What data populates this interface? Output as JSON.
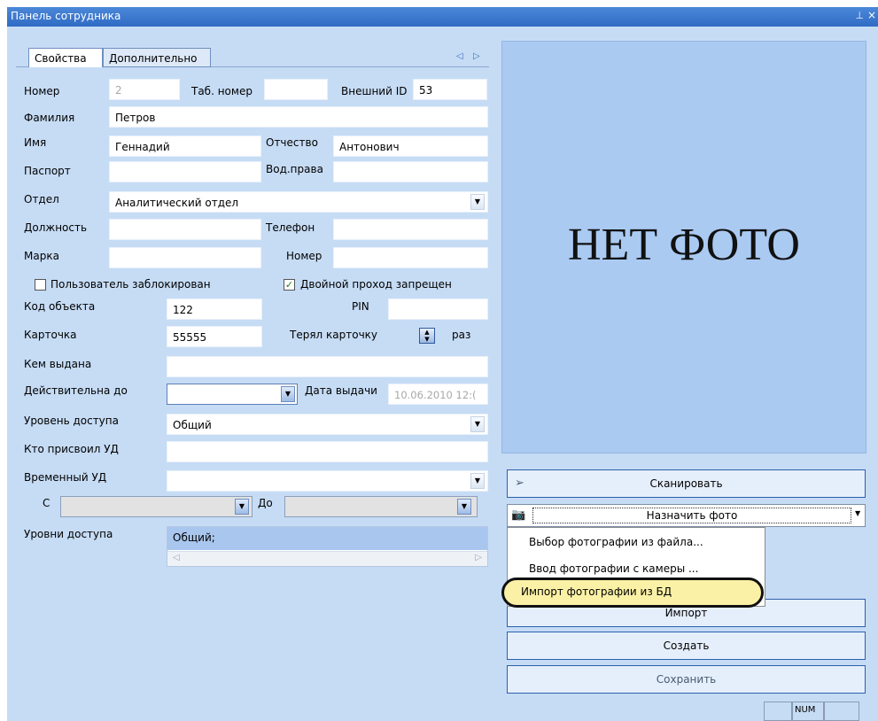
{
  "window": {
    "title": "Панель сотрудника",
    "pin_glyph": "⊥",
    "close_glyph": "×"
  },
  "tabs": [
    {
      "label": "Свойства",
      "active": true
    },
    {
      "label": "Дополнительно",
      "active": false
    }
  ],
  "tab_nav": {
    "prev": "◁",
    "next": "▷"
  },
  "fields": {
    "number": {
      "label": "Номер",
      "value": "2"
    },
    "tab_number": {
      "label": "Таб. номер",
      "value": ""
    },
    "external_id": {
      "label": "Внешний ID",
      "value": "53"
    },
    "surname": {
      "label": "Фамилия",
      "value": "Петров"
    },
    "name": {
      "label": "Имя",
      "value": "Геннадий"
    },
    "patronymic": {
      "label": "Отчество",
      "value": "Антонович"
    },
    "passport": {
      "label": "Паспорт",
      "value": ""
    },
    "license": {
      "label": "Вод.права",
      "value": ""
    },
    "department": {
      "label": "Отдел",
      "value": "Аналитический отдел"
    },
    "position": {
      "label": "Должность",
      "value": ""
    },
    "phone": {
      "label": "Телефон",
      "value": ""
    },
    "brand": {
      "label": "Марка",
      "value": ""
    },
    "plate": {
      "label": "Номер",
      "value": ""
    },
    "object_code": {
      "label": "Код объекта",
      "value": "122"
    },
    "pin": {
      "label": "PIN",
      "value": ""
    },
    "card": {
      "label": "Карточка",
      "value": "55555"
    },
    "lost_card": {
      "label": "Терял карточку",
      "suffix": "раз"
    },
    "issued_by": {
      "label": "Кем выдана",
      "value": ""
    },
    "valid_until": {
      "label": "Действительна до",
      "value": ""
    },
    "issue_date": {
      "label": "Дата выдачи",
      "value": "10.06.2010 12:("
    },
    "access_level": {
      "label": "Уровень доступа",
      "value": "Общий"
    },
    "assigned_by": {
      "label": "Кто присвоил УД",
      "value": ""
    },
    "temp_level": {
      "label": "Временный УД",
      "value": ""
    },
    "from": {
      "label": "С",
      "value": ""
    },
    "to": {
      "label": "До",
      "value": ""
    },
    "access_levels": {
      "label": "Уровни доступа",
      "value": "Общий;"
    }
  },
  "checkboxes": {
    "blocked": {
      "label": "Пользователь заблокирован",
      "checked": false
    },
    "double_pass": {
      "label": "Двойной проход запрещен",
      "checked": true
    }
  },
  "photo": {
    "placeholder": "НЕТ ФОТО"
  },
  "buttons": {
    "scan": "Сканировать",
    "assign_photo": "Назначить фото",
    "import": "Импорт",
    "create": "Создать",
    "save": "Сохранить"
  },
  "photo_menu": [
    "Выбор фотографии из файла...",
    "Ввод фотографии с камеры ...",
    "Импорт фотографии из БД"
  ],
  "status": {
    "num": "NUM"
  },
  "colors": {
    "title_bar": "#2f6bc4",
    "panel": "#c6dcf5",
    "photo_bg": "#aacaf2",
    "highlight": "#fbf1a6"
  }
}
